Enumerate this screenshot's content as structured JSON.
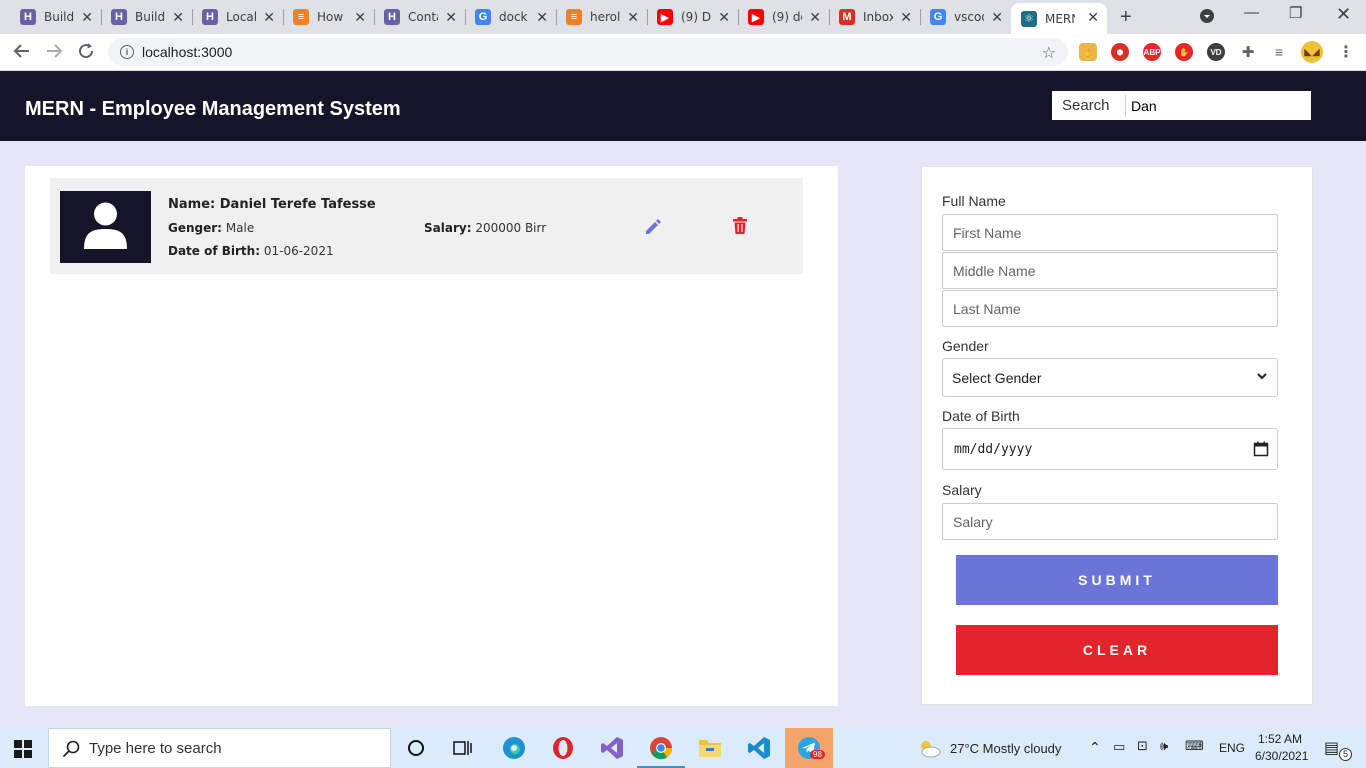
{
  "browser": {
    "tabs": [
      {
        "label": "Build",
        "icon": "heroku-icon",
        "color": "#6762a6"
      },
      {
        "label": "Build",
        "icon": "heroku-icon",
        "color": "#6762a6"
      },
      {
        "label": "Local",
        "icon": "heroku-icon",
        "color": "#6762a6"
      },
      {
        "label": "How",
        "icon": "stackoverflow-icon",
        "color": "#f48024"
      },
      {
        "label": "Conta",
        "icon": "heroku-icon",
        "color": "#6762a6"
      },
      {
        "label": "dock",
        "icon": "google-icon",
        "color": "#4285f4"
      },
      {
        "label": "herol",
        "icon": "stackoverflow-icon",
        "color": "#f48024"
      },
      {
        "label": "(9) D",
        "icon": "youtube-icon",
        "color": "#ff0000"
      },
      {
        "label": "(9) do",
        "icon": "youtube-icon",
        "color": "#ff0000"
      },
      {
        "label": "Inbox",
        "icon": "gmail-icon",
        "color": "#d93025"
      },
      {
        "label": "vscod",
        "icon": "google-icon",
        "color": "#4285f4"
      },
      {
        "label": "MERN",
        "icon": "react-icon",
        "color": "#1b6f86"
      }
    ],
    "url": "localhost:3000"
  },
  "header": {
    "title": "MERN - Employee Management System",
    "search_label": "Search",
    "search_value": "Dan"
  },
  "employees": [
    {
      "name_label": "Name:",
      "name": "Daniel Terefe Tafesse",
      "gender_label": "Genger:",
      "gender": "Male",
      "dob_label": "Date of Birth:",
      "dob": "01-06-2021",
      "salary_label": "Salary:",
      "salary": "200000 Birr"
    }
  ],
  "form": {
    "full_name_label": "Full Name",
    "first_name_placeholder": "First Name",
    "middle_name_placeholder": "Middle Name",
    "last_name_placeholder": "Last Name",
    "gender_label": "Gender",
    "gender_selected": "Select Gender",
    "dob_label": "Date of Birth",
    "dob_placeholder": "mm/dd/yyyy",
    "salary_label": "Salary",
    "salary_placeholder": "Salary",
    "submit_label": "SUBMIT",
    "clear_label": "CLEAR"
  },
  "colors": {
    "header_bg": "#15152a",
    "page_bg": "#e6e6f8",
    "submit": "#6b75d8",
    "clear": "#e3242b",
    "edit_icon": "#6b75d8",
    "delete_icon": "#e3242b"
  },
  "taskbar": {
    "search_placeholder": "Type here to search",
    "weather": "27°C  Mostly cloudy",
    "language": "ENG",
    "time": "1:52 AM",
    "date": "6/30/2021",
    "telegram_badge": "98",
    "notification_count": "5"
  }
}
